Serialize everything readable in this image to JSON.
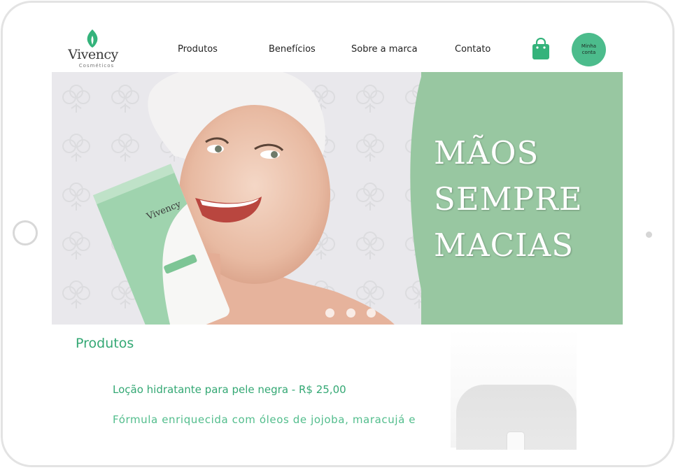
{
  "brand": {
    "name": "Vivency",
    "tagline": "Cosméticos",
    "accent": "#4cbc8c",
    "hero_green": "#98c7a1"
  },
  "nav": {
    "items": [
      {
        "label": "Produtos"
      },
      {
        "label": "Benefícios"
      },
      {
        "label": "Sobre a marca"
      },
      {
        "label": "Contato"
      }
    ],
    "cart_icon": "shopping-bag-icon",
    "account_label": "Minha conta"
  },
  "hero": {
    "title_lines": [
      "MÃOS",
      "SEMPRE",
      "MACIAS"
    ],
    "carousel_dots": 3,
    "product_label": "Vivency"
  },
  "products": {
    "section_title": "Produtos",
    "items": [
      {
        "name": "Loção hidratante para pele negra - R$ 25,00",
        "description": "Fórmula enriquecida com óleos de jojoba, maracujá e"
      }
    ]
  }
}
